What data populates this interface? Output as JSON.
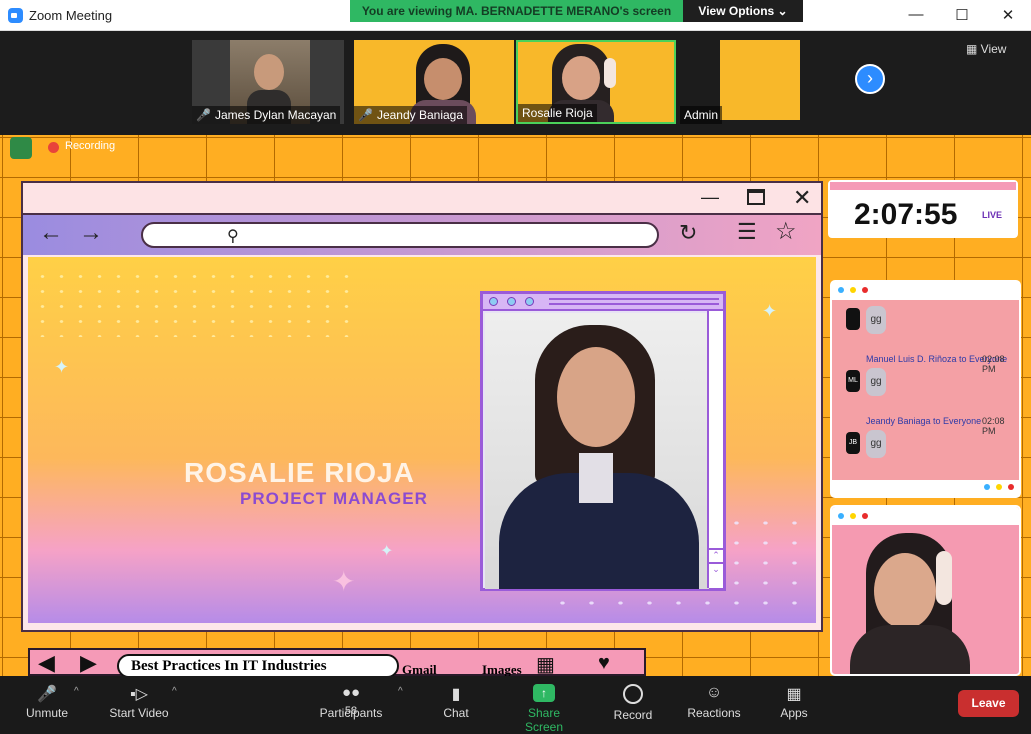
{
  "window": {
    "title": "Zoom Meeting"
  },
  "banner": {
    "text": "You are viewing MA. BERNADETTE MERANO's screen",
    "view_options": "View Options ⌄"
  },
  "participants_strip": {
    "tiles": [
      {
        "name": "James Dylan Macayan",
        "muted": true
      },
      {
        "name": "Jeandy Baniaga",
        "muted": true
      },
      {
        "name": "Rosalie Rioja",
        "muted": false
      },
      {
        "name": "Admin",
        "muted": false
      }
    ],
    "view_label": "View"
  },
  "recording": {
    "label": "Recording"
  },
  "slide": {
    "person_name": "ROSALIE RIOJA",
    "person_role": "PROJECT MANAGER"
  },
  "timer": {
    "value": "2:07:55",
    "badge": "LIVE"
  },
  "chat": {
    "messages": [
      {
        "sender": "",
        "initials": "",
        "text": "gg",
        "time": ""
      },
      {
        "sender": "Manuel Luis D. Riñoza to Everyone",
        "initials": "ML",
        "text": "gg",
        "time": "02:08 PM"
      },
      {
        "sender": "Jeandy Baniaga to Everyone",
        "initials": "JB",
        "text": "gg",
        "time": "02:08 PM"
      }
    ]
  },
  "bottom_bar": {
    "title": "Best Practices In IT Industries",
    "gmail": "Gmail",
    "images": "Images"
  },
  "toolbar": {
    "unmute": "Unmute",
    "start_video": "Start Video",
    "participants": "Participants",
    "participants_count": "58",
    "chat": "Chat",
    "share_screen": "Share Screen",
    "record": "Record",
    "reactions": "Reactions",
    "apps": "Apps",
    "leave": "Leave"
  },
  "colors": {
    "accent": "#2d8cff",
    "share_green": "#2fb863",
    "leave_red": "#c92f2f"
  }
}
